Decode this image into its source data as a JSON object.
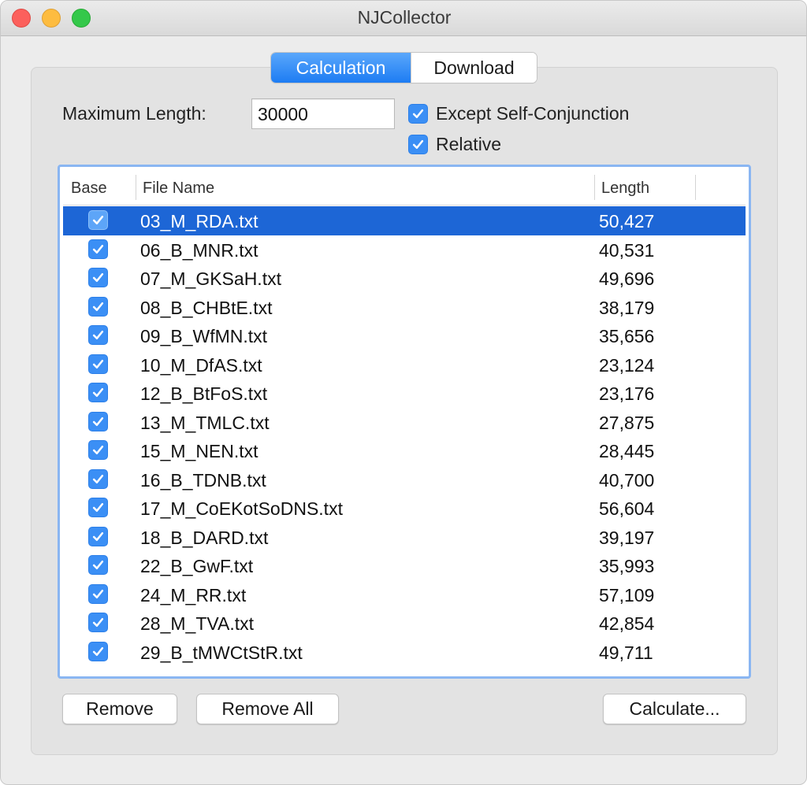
{
  "window": {
    "title": "NJCollector"
  },
  "tabs": [
    {
      "label": "Calculation",
      "active": true
    },
    {
      "label": "Download",
      "active": false
    }
  ],
  "settings": {
    "max_length_label": "Maximum Length:",
    "max_length_value": "30000",
    "except_self_label": "Except Self-Conjunction",
    "except_self_checked": true,
    "relative_label": "Relative",
    "relative_checked": true
  },
  "table": {
    "columns": [
      "Base",
      "File Name",
      "Length"
    ],
    "selected_row": 0,
    "rows": [
      {
        "base": true,
        "file": "03_M_RDA.txt",
        "length": "50,427"
      },
      {
        "base": true,
        "file": "06_B_MNR.txt",
        "length": "40,531"
      },
      {
        "base": true,
        "file": "07_M_GKSaH.txt",
        "length": "49,696"
      },
      {
        "base": true,
        "file": "08_B_CHBtE.txt",
        "length": "38,179"
      },
      {
        "base": true,
        "file": "09_B_WfMN.txt",
        "length": "35,656"
      },
      {
        "base": true,
        "file": "10_M_DfAS.txt",
        "length": "23,124"
      },
      {
        "base": true,
        "file": "12_B_BtFoS.txt",
        "length": "23,176"
      },
      {
        "base": true,
        "file": "13_M_TMLC.txt",
        "length": "27,875"
      },
      {
        "base": true,
        "file": "15_M_NEN.txt",
        "length": "28,445"
      },
      {
        "base": true,
        "file": "16_B_TDNB.txt",
        "length": "40,700"
      },
      {
        "base": true,
        "file": "17_M_CoEKotSoDNS.txt",
        "length": "56,604"
      },
      {
        "base": true,
        "file": "18_B_DARD.txt",
        "length": "39,197"
      },
      {
        "base": true,
        "file": "22_B_GwF.txt",
        "length": "35,993"
      },
      {
        "base": true,
        "file": "24_M_RR.txt",
        "length": "57,109"
      },
      {
        "base": true,
        "file": "28_M_TVA.txt",
        "length": "42,854"
      },
      {
        "base": true,
        "file": "29_B_tMWCtStR.txt",
        "length": "49,711"
      }
    ]
  },
  "buttons": {
    "remove": "Remove",
    "remove_all": "Remove All",
    "calculate": "Calculate..."
  },
  "colors": {
    "accent": "#1d7cf3",
    "selection": "#1d66d6",
    "checkbox": "#3b8ff5"
  }
}
